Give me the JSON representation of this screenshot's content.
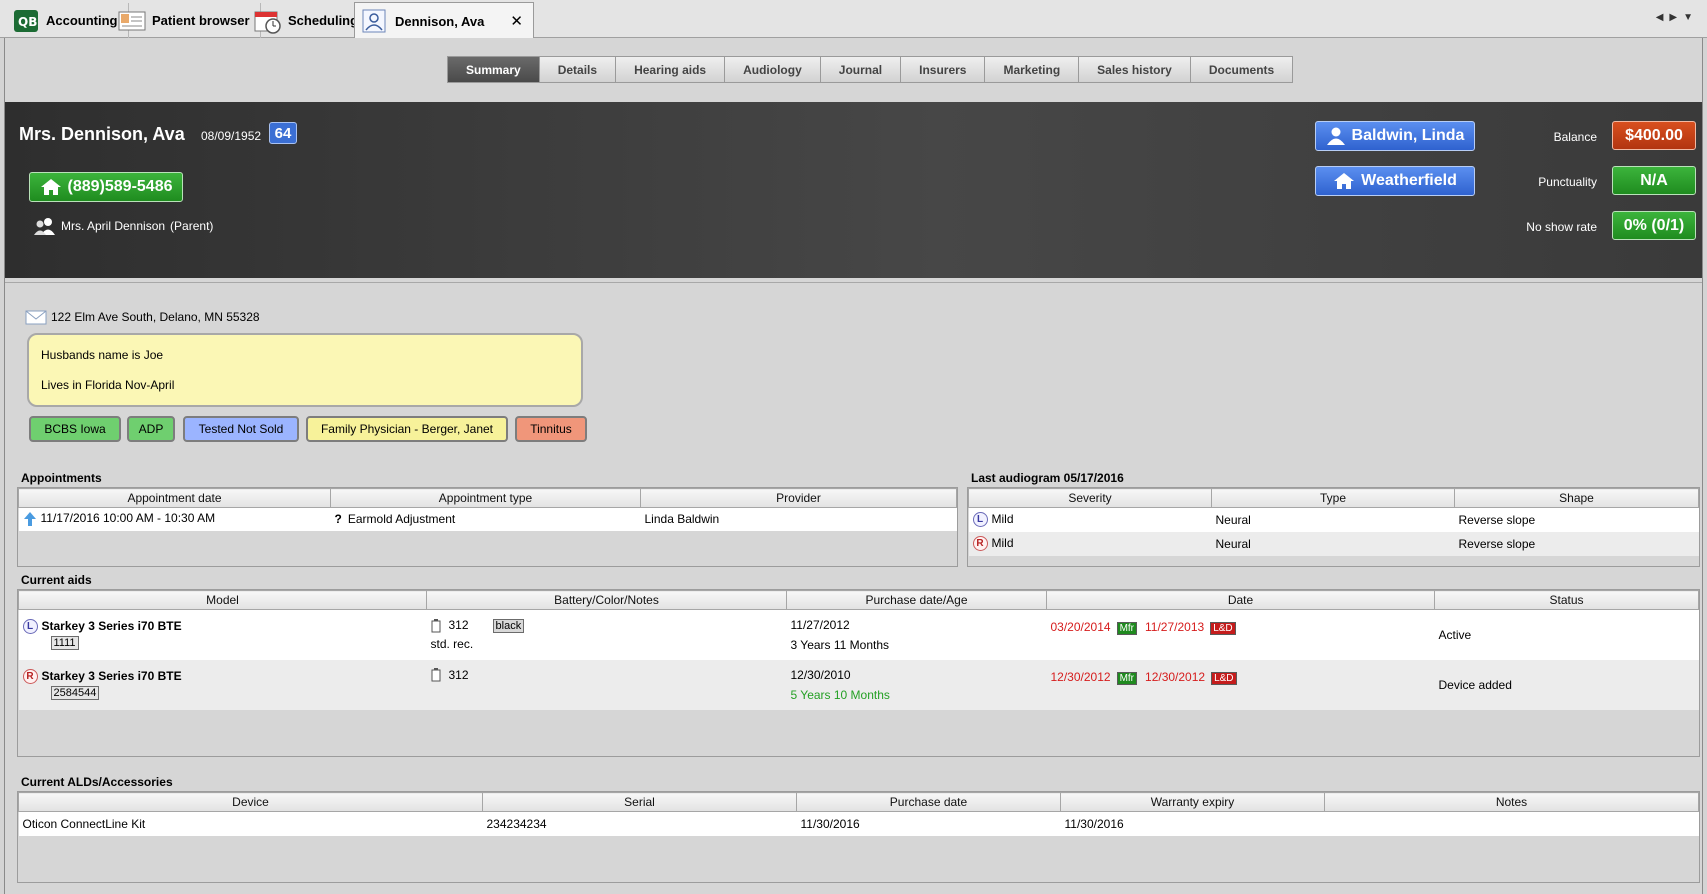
{
  "app_tabs": [
    {
      "label": "Accounting"
    },
    {
      "label": "Patient browser"
    },
    {
      "label": "Scheduling"
    },
    {
      "label": "Dennison, Ava"
    }
  ],
  "section_tabs": [
    "Summary",
    "Details",
    "Hearing aids",
    "Audiology",
    "Journal",
    "Insurers",
    "Marketing",
    "Sales history",
    "Documents"
  ],
  "patient": {
    "name": "Mrs. Dennison, Ava",
    "dob": "08/09/1952",
    "age": "64",
    "phone": "(889)589-5486",
    "contact": "Mrs. April Dennison",
    "contact_relation": "(Parent)",
    "provider": "Baldwin, Linda",
    "location": "Weatherfield"
  },
  "stats": {
    "balance_label": "Balance",
    "balance": "$400.00",
    "punctuality_label": "Punctuality",
    "punctuality": "N/A",
    "noshow_label": "No show rate",
    "noshow": "0% (0/1)"
  },
  "address": "122 Elm Ave South, Delano, MN 55328",
  "notes": [
    "Husbands name is Joe",
    "Lives in Florida Nov-April"
  ],
  "tags": [
    {
      "label": "BCBS Iowa",
      "color": "#6fcf6f"
    },
    {
      "label": "ADP",
      "color": "#6fcf6f"
    },
    {
      "label": "Tested Not Sold",
      "color": "#9bb4ff"
    },
    {
      "label": "Family Physician - Berger, Janet",
      "color": "#f7f29a"
    },
    {
      "label": "Tinnitus",
      "color": "#f0967a"
    }
  ],
  "appointments": {
    "title": "Appointments",
    "headers": [
      "Appointment date",
      "Appointment type",
      "Provider"
    ],
    "rows": [
      {
        "date": "11/17/2016  10:00 AM - 10:30 AM",
        "type_icon": "?",
        "type": "Earmold Adjustment",
        "provider": "Linda Baldwin"
      }
    ]
  },
  "audiogram": {
    "title": "Last audiogram 05/17/2016",
    "headers": [
      "Severity",
      "Type",
      "Shape"
    ],
    "rows": [
      {
        "side": "L",
        "severity": "Mild",
        "type": "Neural",
        "shape": "Reverse slope"
      },
      {
        "side": "R",
        "severity": "Mild",
        "type": "Neural",
        "shape": "Reverse slope"
      }
    ]
  },
  "current_aids": {
    "title": "Current aids",
    "headers": [
      "Model",
      "Battery/Color/Notes",
      "Purchase date/Age",
      "Date",
      "Status"
    ],
    "rows": [
      {
        "side": "L",
        "model": "Starkey 3 Series i70 BTE",
        "serial": "1111",
        "battery": "312",
        "color": "black",
        "notes": "std. rec.",
        "purchase_date": "11/27/2012",
        "age": "3 Years 11 Months",
        "mfr_date": "03/20/2014",
        "mfr_badge": "Mfr",
        "ld_date": "11/27/2013",
        "ld_badge": "L&D",
        "status": "Active"
      },
      {
        "side": "R",
        "model": "Starkey 3 Series i70 BTE",
        "serial": "2584544",
        "battery": "312",
        "color": "",
        "notes": "",
        "purchase_date": "12/30/2010",
        "age": "5 Years 10 Months",
        "mfr_date": "12/30/2012",
        "mfr_badge": "Mfr",
        "ld_date": "12/30/2012",
        "ld_badge": "L&D",
        "status": "Device added"
      }
    ]
  },
  "alds": {
    "title": "Current ALDs/Accessories",
    "headers": [
      "Device",
      "Serial",
      "Purchase date",
      "Warranty expiry",
      "Notes"
    ],
    "rows": [
      {
        "device": "Oticon ConnectLine Kit",
        "serial": "234234234",
        "purchase_date": "11/30/2016",
        "warranty": "11/30/2016",
        "notes": ""
      }
    ]
  }
}
